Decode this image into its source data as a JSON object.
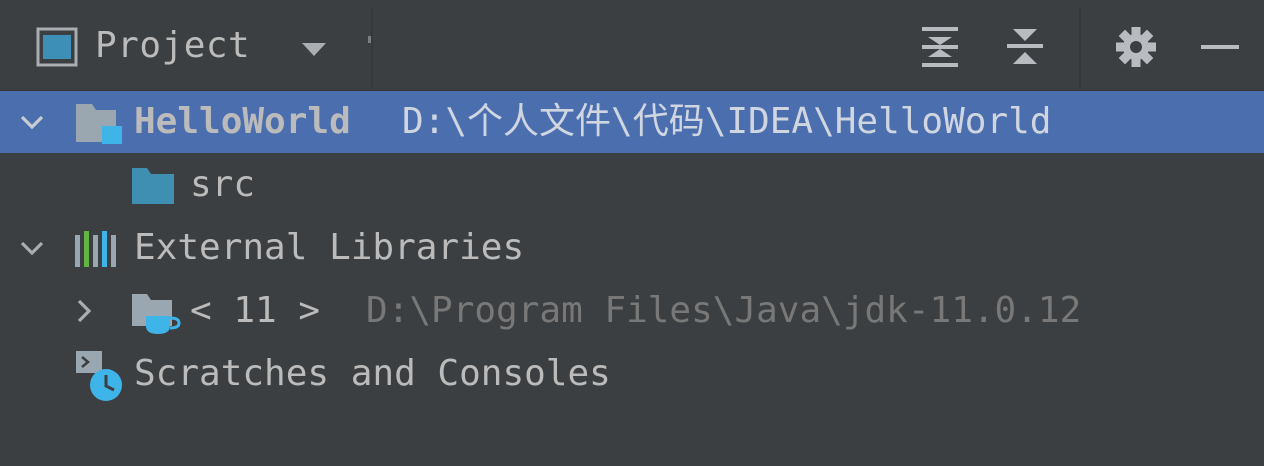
{
  "header": {
    "title": "Project",
    "icons": [
      "project-view-icon",
      "dropdown-icon",
      "expand-all-icon",
      "collapse-all-icon",
      "gear-icon",
      "minimize-icon"
    ]
  },
  "tree": {
    "project": {
      "name": "HelloWorld",
      "path": "D:\\个人文件\\代码\\IDEA\\HelloWorld",
      "expanded": true,
      "selected": true
    },
    "src": {
      "name": "src"
    },
    "external_libraries": {
      "name": "External Libraries",
      "expanded": true
    },
    "jdk": {
      "name": "< 11 >",
      "path": "D:\\Program Files\\Java\\jdk-11.0.12",
      "expanded": false
    },
    "scratches": {
      "name": "Scratches and Consoles"
    }
  },
  "colors": {
    "background": "#3c3f41",
    "selection": "#4b6eaf",
    "text": "#bbbbbb",
    "path_text_selected": "#d0d6e0",
    "path_text": "#787878",
    "folder_blue": "#3f8fb3",
    "accent_blue": "#3fb4e8"
  }
}
